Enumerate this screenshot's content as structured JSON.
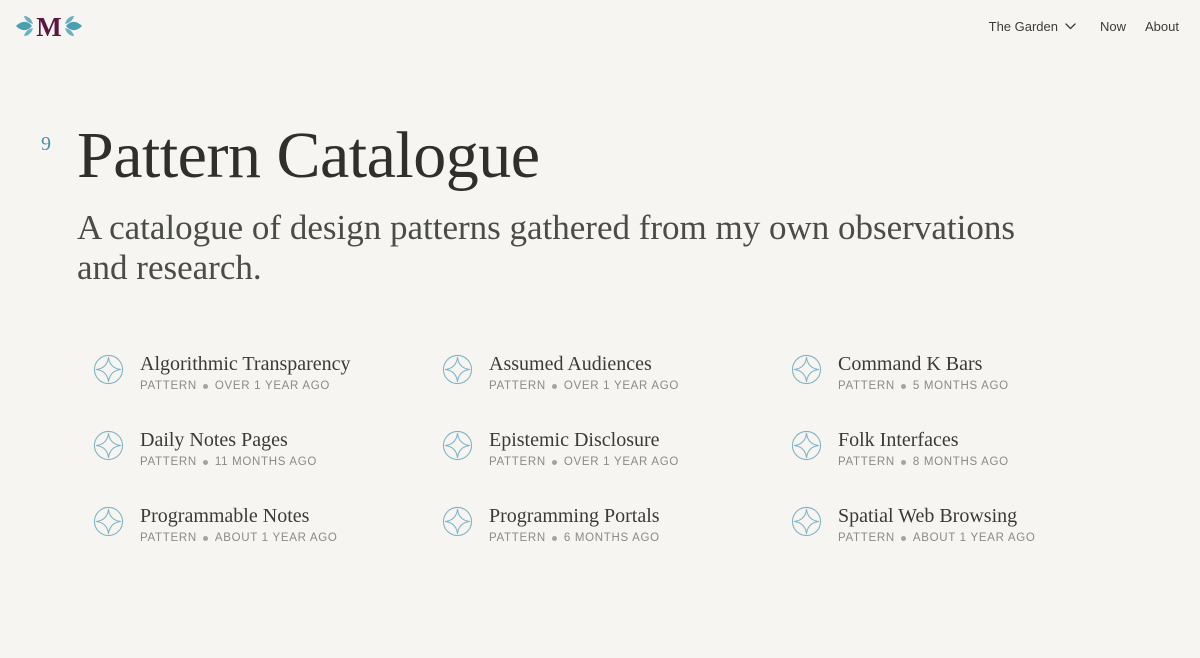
{
  "logo": {
    "letter": "M"
  },
  "nav": {
    "garden_label": "The Garden",
    "now_label": "Now",
    "about_label": "About"
  },
  "header": {
    "count": "9",
    "title": "Pattern Catalogue",
    "subtitle": "A catalogue of design patterns gathered from my own observations and research."
  },
  "patterns": [
    {
      "title": "Algorithmic Transparency",
      "type": "Pattern",
      "age": "Over 1 year ago"
    },
    {
      "title": "Assumed Audiences",
      "type": "Pattern",
      "age": "Over 1 year ago"
    },
    {
      "title": "Command K Bars",
      "type": "Pattern",
      "age": "5 months ago"
    },
    {
      "title": "Daily Notes Pages",
      "type": "Pattern",
      "age": "11 months ago"
    },
    {
      "title": "Epistemic Disclosure",
      "type": "Pattern",
      "age": "Over 1 year ago"
    },
    {
      "title": "Folk Interfaces",
      "type": "Pattern",
      "age": "8 months ago"
    },
    {
      "title": "Programmable Notes",
      "type": "Pattern",
      "age": "About 1 year ago"
    },
    {
      "title": "Programming Portals",
      "type": "Pattern",
      "age": "6 months ago"
    },
    {
      "title": "Spatial Web Browsing",
      "type": "Pattern",
      "age": "About 1 year ago"
    }
  ],
  "icons": {
    "pattern": "sparkle-circle-icon",
    "nav_chevron": "chevron-down-icon"
  },
  "colors": {
    "background": "#f6f5f1",
    "accent_teal": "#4a8fa6",
    "logo_letter": "#5b1740",
    "icon_stroke": "#7fb3c4",
    "meta_text": "#8a8a86"
  }
}
